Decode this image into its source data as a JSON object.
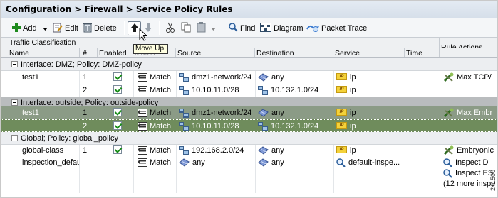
{
  "breadcrumb": "Configuration > Firewall > Service Policy Rules",
  "toolbar": {
    "add_label": "Add",
    "edit_label": "Edit",
    "delete_label": "Delete",
    "find_label": "Find",
    "diagram_label": "Diagram",
    "packet_trace_label": "Packet Trace"
  },
  "tooltip": "Move Up",
  "table": {
    "group_header": "Traffic Classification",
    "columns": {
      "name": "Name",
      "num": "#",
      "enabled": "Enabled",
      "match": "Match",
      "source": "Source",
      "destination": "Destination",
      "service": "Service",
      "time": "Time",
      "rule_actions": "Rule Actions"
    },
    "groups": [
      {
        "label": "Interface: DMZ; Policy: DMZ-policy"
      },
      {
        "label": "Interface: outside; Policy: outside-policy"
      },
      {
        "label": "Global; Policy: global_policy"
      }
    ],
    "rows": [
      {
        "name": "test1",
        "num": "1",
        "match": "Match",
        "source": "dmz1-network/24",
        "destination": "any",
        "service": "ip",
        "action": "Max TCP/"
      },
      {
        "name": "",
        "num": "2",
        "match": "Match",
        "source": "10.10.11.0/28",
        "destination": "10.132.1.0/24",
        "service": "ip",
        "action": ""
      },
      {
        "name": "test1",
        "num": "1",
        "match": "Match",
        "source": "dmz1-network/24",
        "destination": "any",
        "service": "ip",
        "action": "Max Embr"
      },
      {
        "name": "",
        "num": "2",
        "match": "Match",
        "source": "10.10.11.0/28",
        "destination": "10.132.1.0/24",
        "service": "ip",
        "action": ""
      },
      {
        "name": "global-class",
        "num": "1",
        "match": "Match",
        "source": "192.168.2.0/24",
        "destination": "any",
        "service": "ip",
        "action": "Embryonic"
      },
      {
        "name": "inspection_defau",
        "num": "",
        "match": "Match",
        "source": "any",
        "destination": "any",
        "service": "default-inspe...",
        "action": "Inspect D"
      }
    ],
    "extra_actions": [
      "Inspect ES",
      "(12 more inspe"
    ]
  },
  "figure_id": "241500"
}
